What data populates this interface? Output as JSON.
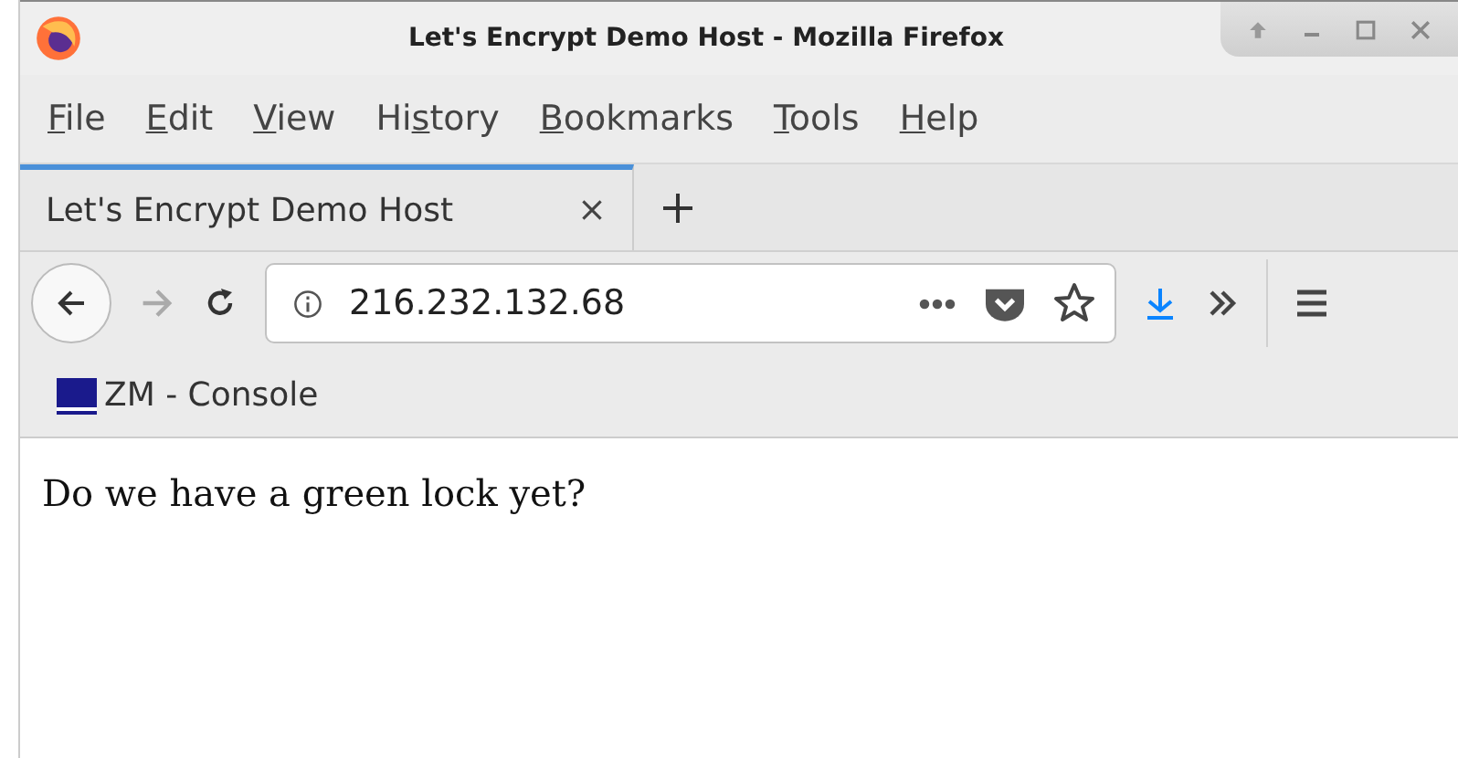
{
  "window": {
    "title": "Let's Encrypt Demo Host - Mozilla Firefox"
  },
  "menu": [
    {
      "key": "F",
      "after": "ile"
    },
    {
      "key": "E",
      "after": "dit"
    },
    {
      "key": "V",
      "after": "iew"
    },
    {
      "before": "Hi",
      "key": "s",
      "after": "tory"
    },
    {
      "key": "B",
      "after": "ookmarks"
    },
    {
      "key": "T",
      "after": "ools"
    },
    {
      "key": "H",
      "after": "elp"
    }
  ],
  "tabs": [
    {
      "label": "Let's Encrypt Demo Host",
      "selected": true
    }
  ],
  "nav": {
    "forward_disabled": true,
    "url": "216.232.132.68"
  },
  "bookmarks": [
    {
      "label": "ZM - Console"
    }
  ],
  "page": {
    "text": "Do we have a green lock yet?"
  }
}
